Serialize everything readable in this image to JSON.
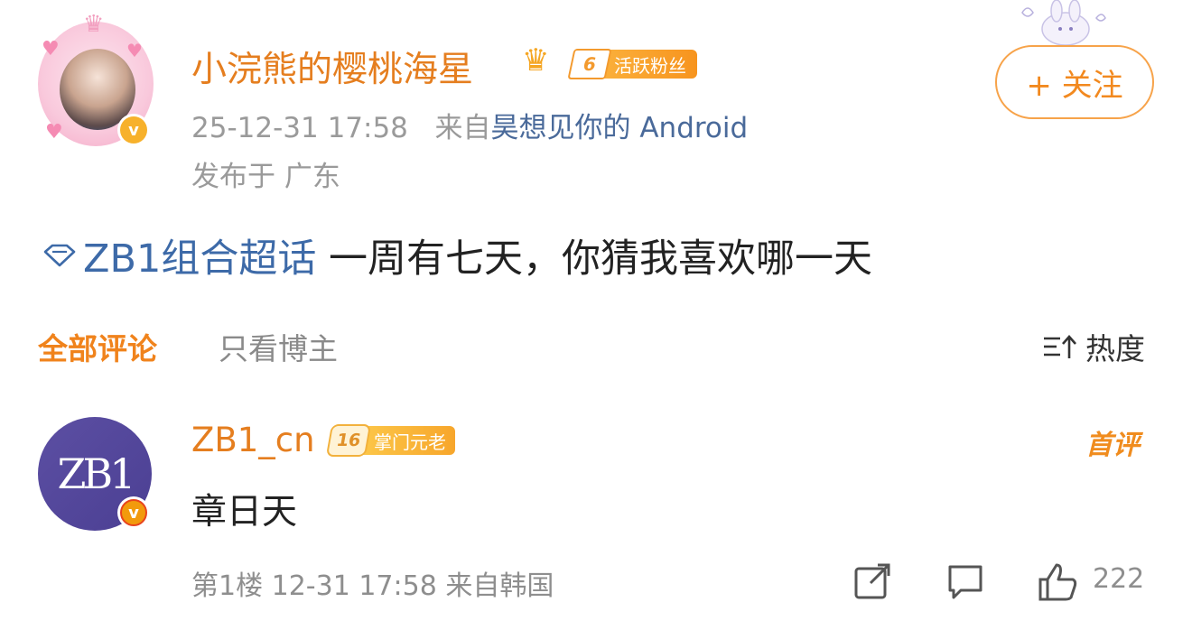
{
  "post": {
    "author": "小浣熊的樱桃海星",
    "fan_badge_level": "6",
    "fan_badge_label": "活跃粉丝",
    "verified_mark": "v",
    "time": "25-12-31 17:58",
    "source_prefix": "来自",
    "source": "昊想见你的 Android",
    "location": "发布于 广东",
    "follow_label": "+ 关注",
    "topic": "ZB1组合超话",
    "text": "一周有七天，你猜我喜欢哪一天"
  },
  "comments_tabs": {
    "all": "全部评论",
    "owner_only": "只看博主",
    "sort_label": "热度"
  },
  "comment": {
    "avatar_text": "ZB1",
    "author": "ZB1_cn",
    "badge_level": "16",
    "badge_label": "掌门元老",
    "verified_mark": "v",
    "first_label": "首评",
    "text": "章日天",
    "meta": "第1楼 12-31 17:58 来自韩国",
    "like_count": "222"
  },
  "colors": {
    "accent": "#e57e1f",
    "link": "#3d6aa8",
    "muted": "#9a9a9a"
  },
  "icons": [
    "topic-diamond-icon",
    "sort-icon",
    "share-icon",
    "comment-icon",
    "like-icon",
    "crown-icon",
    "verified-icon"
  ]
}
